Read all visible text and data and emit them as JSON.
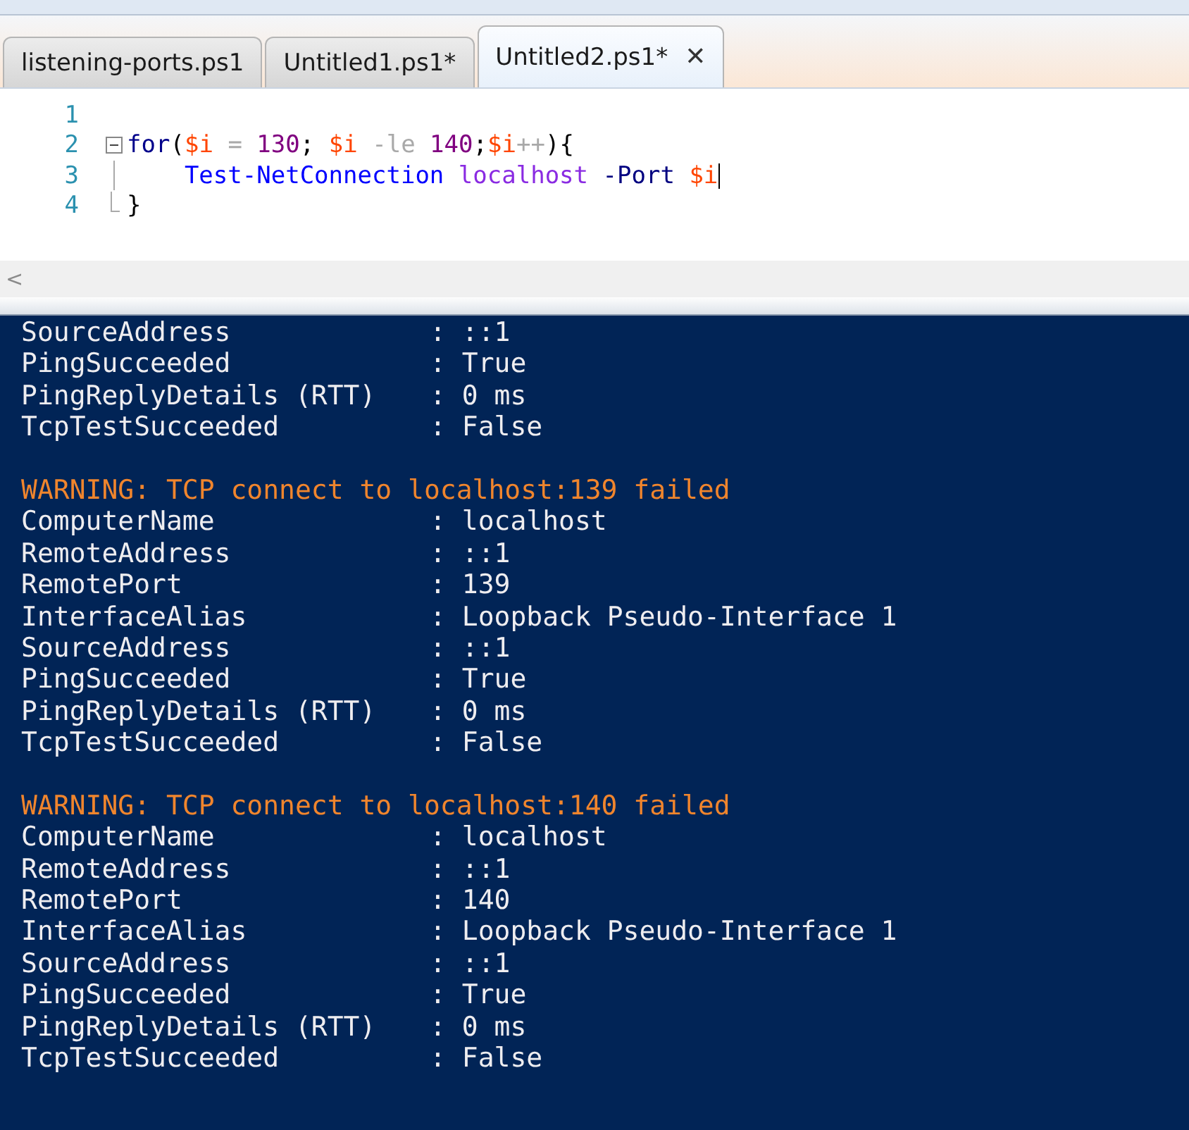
{
  "tabs": [
    {
      "label": "listening-ports.ps1",
      "selected": false
    },
    {
      "label": "Untitled1.ps1*",
      "selected": false
    },
    {
      "label": "Untitled2.ps1*",
      "selected": true,
      "close": "✕"
    }
  ],
  "editor": {
    "lines": [
      {
        "number": "1",
        "kind": "plain"
      },
      {
        "number": "2",
        "kind": "fold-start",
        "indented": false,
        "tokens": [
          {
            "t": "for",
            "kind": "keyword"
          },
          {
            "t": "(",
            "kind": "plain"
          },
          {
            "t": "$i",
            "kind": "variable"
          },
          {
            "t": " = ",
            "kind": "operator"
          },
          {
            "t": "130",
            "kind": "number"
          },
          {
            "t": "; ",
            "kind": "plain"
          },
          {
            "t": "$i",
            "kind": "variable"
          },
          {
            "t": " -le ",
            "kind": "operator"
          },
          {
            "t": "140",
            "kind": "number"
          },
          {
            "t": ";",
            "kind": "plain"
          },
          {
            "t": "$i",
            "kind": "variable"
          },
          {
            "t": "++",
            "kind": "operator"
          },
          {
            "t": "){",
            "kind": "plain"
          }
        ]
      },
      {
        "number": "3",
        "kind": "fold-inner",
        "indented": true,
        "tokens": [
          {
            "t": "Test-NetConnection",
            "kind": "command"
          },
          {
            "t": " localhost",
            "kind": "argument"
          },
          {
            "t": " -Port",
            "kind": "parameter"
          },
          {
            "t": " $i",
            "kind": "variable"
          }
        ],
        "caret": true
      },
      {
        "number": "4",
        "kind": "fold-end",
        "indented": false,
        "tokens": [
          {
            "t": "}",
            "kind": "plain"
          }
        ]
      }
    ],
    "scroll_left": "<"
  },
  "console": {
    "lines": [
      {
        "kind": "field",
        "key": "SourceAddress",
        "value": ": ::1"
      },
      {
        "kind": "field",
        "key": "PingSucceeded",
        "value": ": True"
      },
      {
        "kind": "field",
        "key": "PingReplyDetails (RTT)",
        "value": ": 0 ms"
      },
      {
        "kind": "field",
        "key": "TcpTestSucceeded",
        "value": ": False"
      },
      {
        "kind": "blank"
      },
      {
        "kind": "warning",
        "text": "WARNING: TCP connect to localhost:139 failed"
      },
      {
        "kind": "field",
        "key": "ComputerName",
        "value": ": localhost"
      },
      {
        "kind": "field",
        "key": "RemoteAddress",
        "value": ": ::1"
      },
      {
        "kind": "field",
        "key": "RemotePort",
        "value": ": 139"
      },
      {
        "kind": "field",
        "key": "InterfaceAlias",
        "value": ": Loopback Pseudo-Interface 1"
      },
      {
        "kind": "field",
        "key": "SourceAddress",
        "value": ": ::1"
      },
      {
        "kind": "field",
        "key": "PingSucceeded",
        "value": ": True"
      },
      {
        "kind": "field",
        "key": "PingReplyDetails (RTT)",
        "value": ": 0 ms"
      },
      {
        "kind": "field",
        "key": "TcpTestSucceeded",
        "value": ": False"
      },
      {
        "kind": "blank"
      },
      {
        "kind": "warning",
        "text": "WARNING: TCP connect to localhost:140 failed"
      },
      {
        "kind": "field",
        "key": "ComputerName",
        "value": ": localhost"
      },
      {
        "kind": "field",
        "key": "RemoteAddress",
        "value": ": ::1"
      },
      {
        "kind": "field",
        "key": "RemotePort",
        "value": ": 140"
      },
      {
        "kind": "field",
        "key": "InterfaceAlias",
        "value": ": Loopback Pseudo-Interface 1"
      },
      {
        "kind": "field",
        "key": "SourceAddress",
        "value": ": ::1"
      },
      {
        "kind": "field",
        "key": "PingSucceeded",
        "value": ": True"
      },
      {
        "kind": "field",
        "key": "PingReplyDetails (RTT)",
        "value": ": 0 ms"
      },
      {
        "kind": "field",
        "key": "TcpTestSucceeded",
        "value": ": False"
      }
    ]
  }
}
